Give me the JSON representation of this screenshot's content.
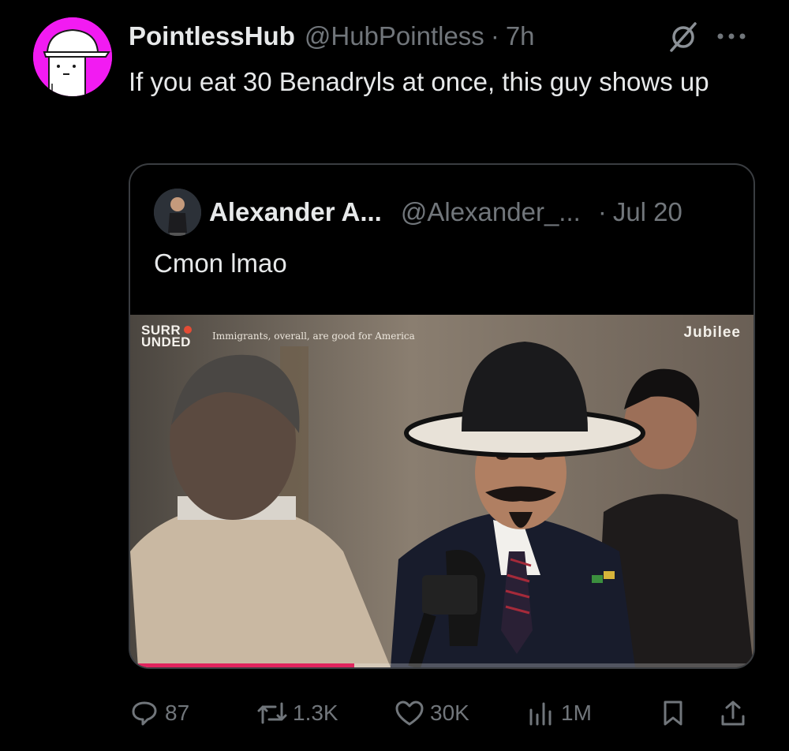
{
  "tweet": {
    "display_name": "PointlessHub",
    "handle": "@HubPointless",
    "separator": "·",
    "time": "7h",
    "text": "If you eat 30 Benadryls at once, this guy shows up",
    "avatar_color": "#f21bf2"
  },
  "quote": {
    "display_name": "Alexander A...",
    "handle": "@Alexander_...",
    "separator": "·",
    "time": "Jul 20",
    "text": "Cmon lmao",
    "media": {
      "brand": "SURR UNDED",
      "brand_line1": "SURR",
      "brand_line2": "UNDED",
      "caption": "Immigrants, overall, are good for America",
      "watermark": "Jubilee",
      "progress": 0.36
    }
  },
  "actions": {
    "replies": "87",
    "retweets": "1.3K",
    "likes": "30K",
    "views": "1M"
  },
  "colors": {
    "background": "#000000",
    "text": "#e7e9ea",
    "muted": "#71767b",
    "border": "#3a3d41",
    "progress": "#e0245e"
  },
  "icons": [
    "grok-icon",
    "more-icon",
    "reply-icon",
    "retweet-icon",
    "like-icon",
    "views-icon",
    "bookmark-icon",
    "share-icon"
  ]
}
